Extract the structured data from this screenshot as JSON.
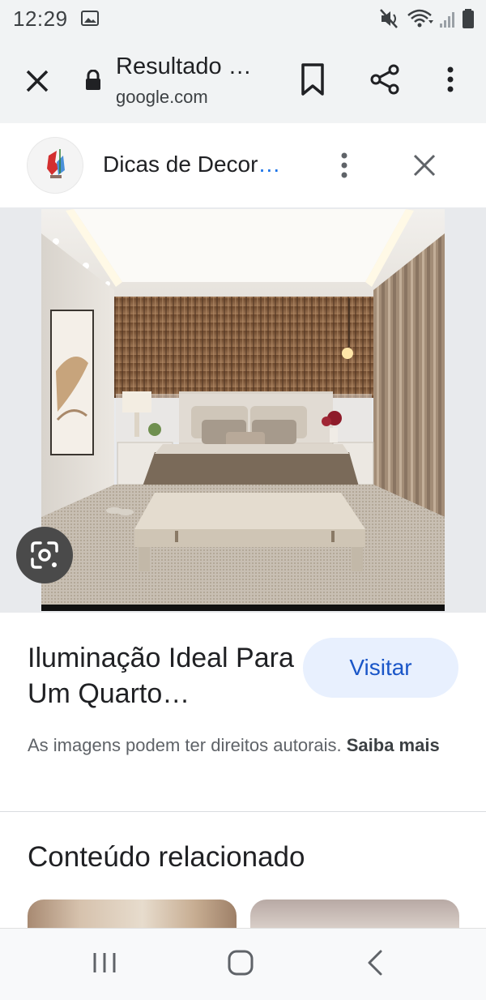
{
  "status_bar": {
    "time": "12:29"
  },
  "toolbar": {
    "title": "Resultado …",
    "url": "google.com"
  },
  "source": {
    "name": "Dicas de Decor",
    "name_ellipsis": "…"
  },
  "caption": {
    "title": "Iluminação Ideal Para Um Quarto…",
    "visit_label": "Visitar",
    "rights_text": "As imagens podem ter direitos autorais. ",
    "learn_more_label": "Saiba mais"
  },
  "related": {
    "title": "Conteúdo relacionado"
  },
  "colors": {
    "toolbar_bg": "#f1f3f4",
    "accent": "#1a56c8",
    "visit_bg": "#e8f0fe"
  }
}
